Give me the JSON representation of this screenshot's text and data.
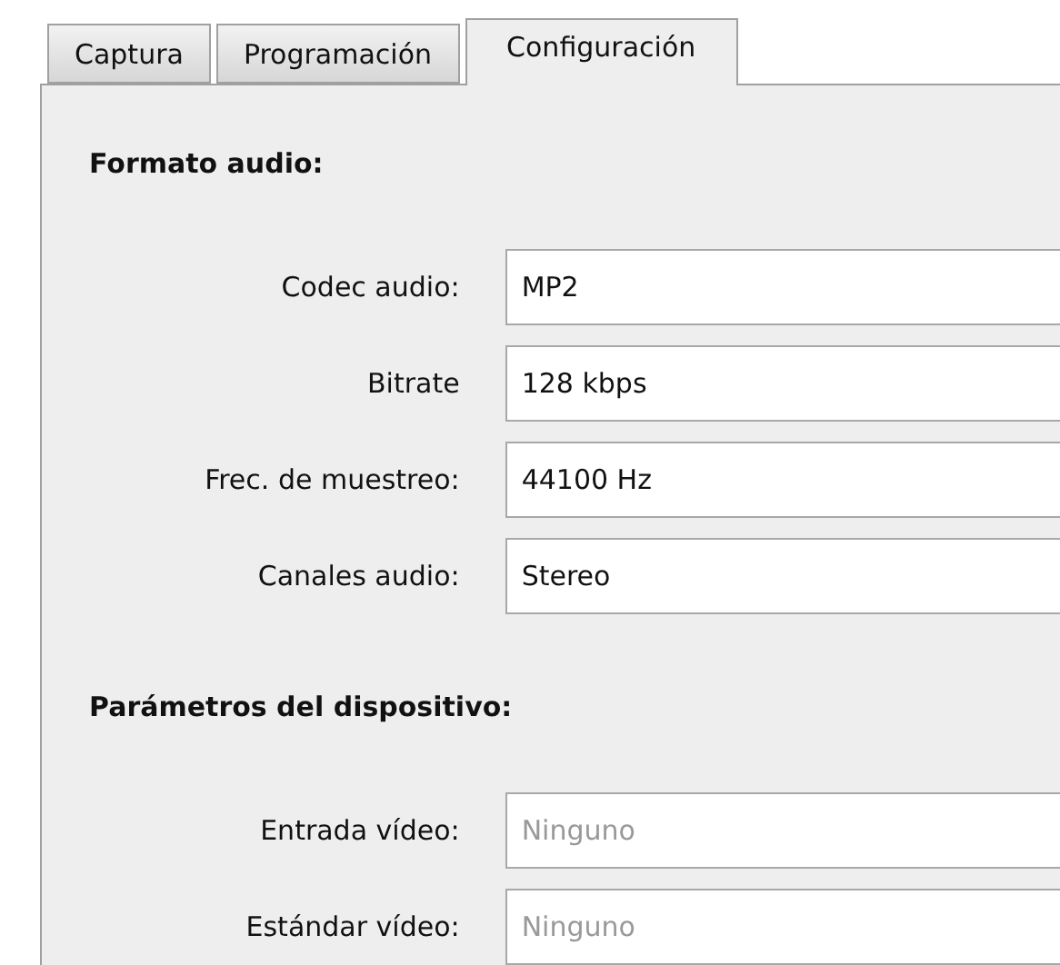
{
  "tabs": [
    {
      "label": "Captura",
      "selected": false
    },
    {
      "label": "Programación",
      "selected": false
    },
    {
      "label": "Configuración",
      "selected": true
    }
  ],
  "sections": [
    {
      "heading": "Formato audio:",
      "fields": [
        {
          "label": "Codec audio:",
          "value": "MP2",
          "disabled": false
        },
        {
          "label": "Bitrate",
          "value": "128 kbps",
          "disabled": false
        },
        {
          "label": "Frec. de muestreo:",
          "value": "44100 Hz",
          "disabled": false
        },
        {
          "label": "Canales audio:",
          "value": "Stereo",
          "disabled": false
        }
      ]
    },
    {
      "heading": "Parámetros del dispositivo:",
      "fields": [
        {
          "label": "Entrada vídeo:",
          "value": "Ninguno",
          "disabled": true
        },
        {
          "label": "Estándar vídeo:",
          "value": "Ninguno",
          "disabled": true
        }
      ]
    }
  ]
}
